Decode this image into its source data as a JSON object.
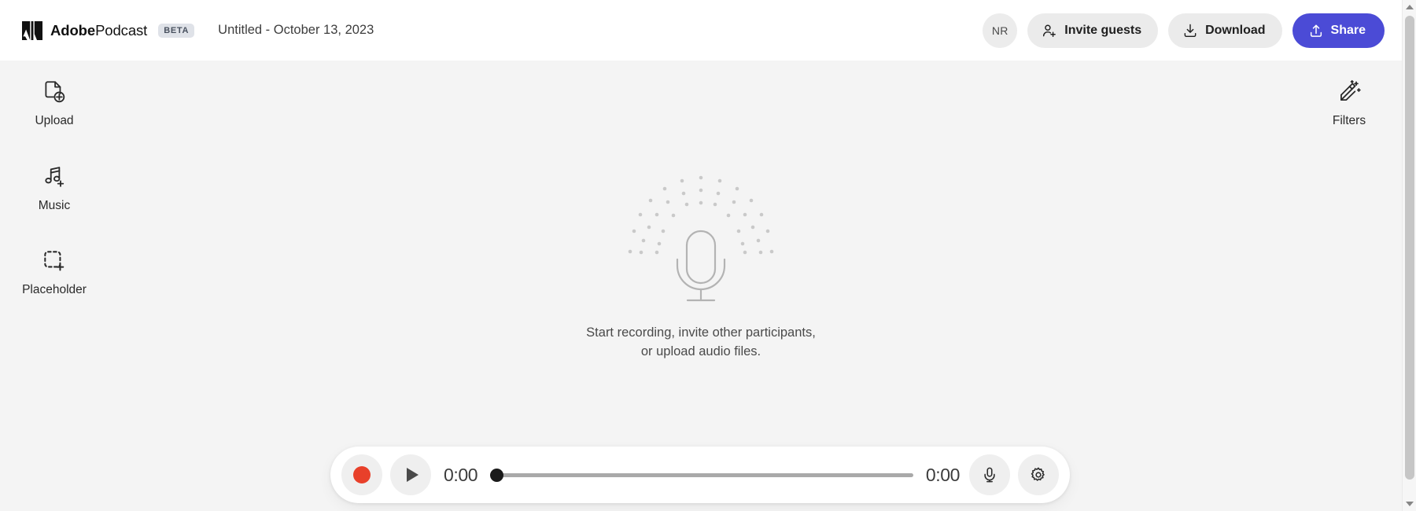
{
  "header": {
    "brand_bold": "Adobe",
    "brand_light": "Podcast",
    "beta_label": "BETA",
    "document_title": "Untitled - October 13, 2023",
    "avatar_initials": "NR",
    "invite_label": "Invite guests",
    "download_label": "Download",
    "share_label": "Share",
    "accent_color": "#4b4bd6",
    "background_color": "#ffffff"
  },
  "left_rail": {
    "items": [
      {
        "label": "Upload",
        "icon": "file-plus-icon"
      },
      {
        "label": "Music",
        "icon": "music-plus-icon"
      },
      {
        "label": "Placeholder",
        "icon": "dashed-square-plus-icon"
      }
    ]
  },
  "right_rail": {
    "items": [
      {
        "label": "Filters",
        "icon": "magic-wand-icon"
      }
    ]
  },
  "stage": {
    "empty_state_icon": "microphone-with-dots-icon",
    "empty_line1": "Start recording, invite other participants,",
    "empty_line2": "or upload audio files."
  },
  "player": {
    "record_label": "Record",
    "play_label": "Play",
    "current_time": "0:00",
    "total_time": "0:00",
    "progress_percent": 0,
    "mic_label": "Microphone",
    "settings_label": "Settings",
    "record_color": "#e8402a",
    "track_color": "#a9a9a9"
  },
  "page": {
    "background_color": "#f4f4f4"
  }
}
